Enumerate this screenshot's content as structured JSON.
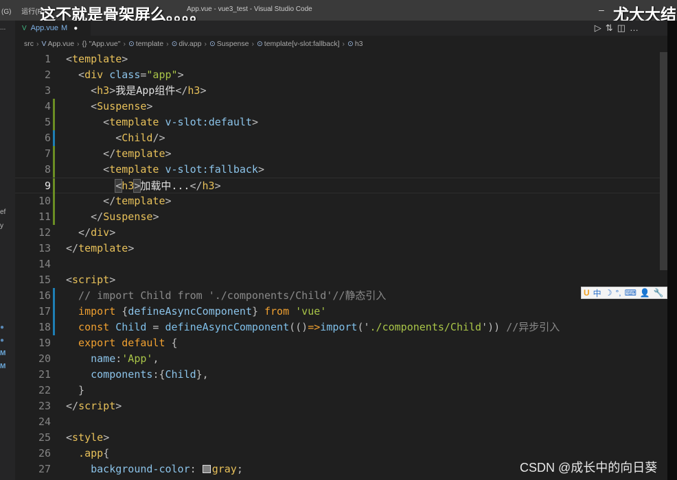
{
  "titlebar": {
    "menu": [
      "(G)",
      "运行(R)"
    ],
    "title": "App.vue - vue3_test - Visual Studio Code"
  },
  "overlay": {
    "left": "这不就是骨架屏么。。。。",
    "right": "尤大大结"
  },
  "leftbar": [
    "...",
    "ef",
    "y",
    "●",
    "●",
    "M",
    "M"
  ],
  "tab": {
    "icon": "vue-icon",
    "label": "App.vue",
    "status": "M",
    "dirty": "●"
  },
  "actions": [
    "run-icon",
    "compare-icon",
    "split-editor-icon",
    "more-icon"
  ],
  "breadcrumb": [
    "src",
    "App.vue",
    "{} \"App.vue\"",
    "template",
    "div.app",
    "Suspense",
    "template[v-slot:fallback]",
    "h3"
  ],
  "current_line": 9,
  "lines": [
    [
      [
        "<",
        "p"
      ],
      [
        "template",
        "tag"
      ],
      [
        ">",
        "p"
      ]
    ],
    [
      [
        "  <",
        "p"
      ],
      [
        "div",
        "tag"
      ],
      [
        " class",
        "attr"
      ],
      [
        "=",
        "p"
      ],
      [
        "\"app\"",
        "str"
      ],
      [
        ">",
        "p"
      ]
    ],
    [
      [
        "    <",
        "p"
      ],
      [
        "h3",
        "tag"
      ],
      [
        ">",
        "p"
      ],
      [
        "我是App组件",
        "txt"
      ],
      [
        "</",
        "p"
      ],
      [
        "h3",
        "tag"
      ],
      [
        ">",
        "p"
      ]
    ],
    [
      [
        "    <",
        "p"
      ],
      [
        "Suspense",
        "tag"
      ],
      [
        ">",
        "p"
      ]
    ],
    [
      [
        "      <",
        "p"
      ],
      [
        "template",
        "tag"
      ],
      [
        " v-slot:default",
        "attr"
      ],
      [
        ">",
        "p"
      ]
    ],
    [
      [
        "        <",
        "p"
      ],
      [
        "Child",
        "tag"
      ],
      [
        "/>",
        "p"
      ]
    ],
    [
      [
        "      </",
        "p"
      ],
      [
        "template",
        "tag"
      ],
      [
        ">",
        "p"
      ]
    ],
    [
      [
        "      <",
        "p"
      ],
      [
        "template",
        "tag"
      ],
      [
        " v-slot:fallback",
        "attr"
      ],
      [
        ">",
        "p"
      ]
    ],
    [
      [
        "        ",
        "p"
      ],
      [
        "<",
        "p bracket"
      ],
      [
        "h3",
        "tag"
      ],
      [
        ">",
        "p bracket"
      ],
      [
        "加载中...",
        "txt"
      ],
      [
        "</",
        "p"
      ],
      [
        "h3",
        "tag"
      ],
      [
        ">",
        "p"
      ]
    ],
    [
      [
        "      </",
        "p"
      ],
      [
        "template",
        "tag"
      ],
      [
        ">",
        "p"
      ]
    ],
    [
      [
        "    </",
        "p"
      ],
      [
        "Suspense",
        "tag"
      ],
      [
        ">",
        "p"
      ]
    ],
    [
      [
        "  </",
        "p"
      ],
      [
        "div",
        "tag"
      ],
      [
        ">",
        "p"
      ]
    ],
    [
      [
        "</",
        "p"
      ],
      [
        "template",
        "tag"
      ],
      [
        ">",
        "p"
      ]
    ],
    [],
    [
      [
        "<",
        "p"
      ],
      [
        "script",
        "tag"
      ],
      [
        ">",
        "p"
      ]
    ],
    [
      [
        "  // import Child from './components/Child'//静态引入",
        "cm"
      ]
    ],
    [
      [
        "  import",
        "kw"
      ],
      [
        " {",
        "p"
      ],
      [
        "defineAsyncComponent",
        "attr"
      ],
      [
        "} ",
        "p"
      ],
      [
        "from",
        "kw"
      ],
      [
        " 'vue'",
        "str"
      ]
    ],
    [
      [
        "  const",
        "kw"
      ],
      [
        " Child",
        "fn"
      ],
      [
        " = ",
        "p"
      ],
      [
        "defineAsyncComponent",
        "fn"
      ],
      [
        "(()",
        "p"
      ],
      [
        "=>",
        "kw"
      ],
      [
        "import",
        "fn"
      ],
      [
        "('",
        "p"
      ],
      [
        "./components/Child",
        "str"
      ],
      [
        "')) ",
        "p"
      ],
      [
        "//异步引入",
        "cm"
      ]
    ],
    [
      [
        "  export default",
        "kw"
      ],
      [
        " {",
        "p"
      ]
    ],
    [
      [
        "    name",
        "attr"
      ],
      [
        ":",
        "p"
      ],
      [
        "'App'",
        "str"
      ],
      [
        ",",
        "p"
      ]
    ],
    [
      [
        "    components",
        "attr"
      ],
      [
        ":{",
        "p"
      ],
      [
        "Child",
        "attr"
      ],
      [
        "},",
        "p"
      ]
    ],
    [
      [
        "  }",
        "p"
      ]
    ],
    [
      [
        "</",
        "p"
      ],
      [
        "script",
        "tag"
      ],
      [
        ">",
        "p"
      ]
    ],
    [],
    [
      [
        "<",
        "p"
      ],
      [
        "style",
        "tag"
      ],
      [
        ">",
        "p"
      ]
    ],
    [
      [
        "  .app",
        "sel"
      ],
      [
        "{",
        "p"
      ]
    ],
    [
      [
        "    background-color",
        "attr"
      ],
      [
        ": ",
        "p"
      ],
      [
        "SWATCH",
        "sw"
      ],
      [
        "gray",
        "val"
      ],
      [
        ";",
        "p"
      ]
    ]
  ],
  "gutter": {
    "modified": [
      4,
      5,
      7,
      8,
      9,
      10,
      11
    ],
    "added": [
      6,
      16,
      17,
      18
    ]
  },
  "colors": {
    "modified": "#6b8e23",
    "added": "#1e7fb5",
    "swatch": "#808080"
  },
  "ime": {
    "items": [
      "U",
      "中",
      "☽",
      "°,",
      "⌨",
      "👤",
      "🔧"
    ]
  },
  "watermark": "CSDN @成长中的向日葵"
}
